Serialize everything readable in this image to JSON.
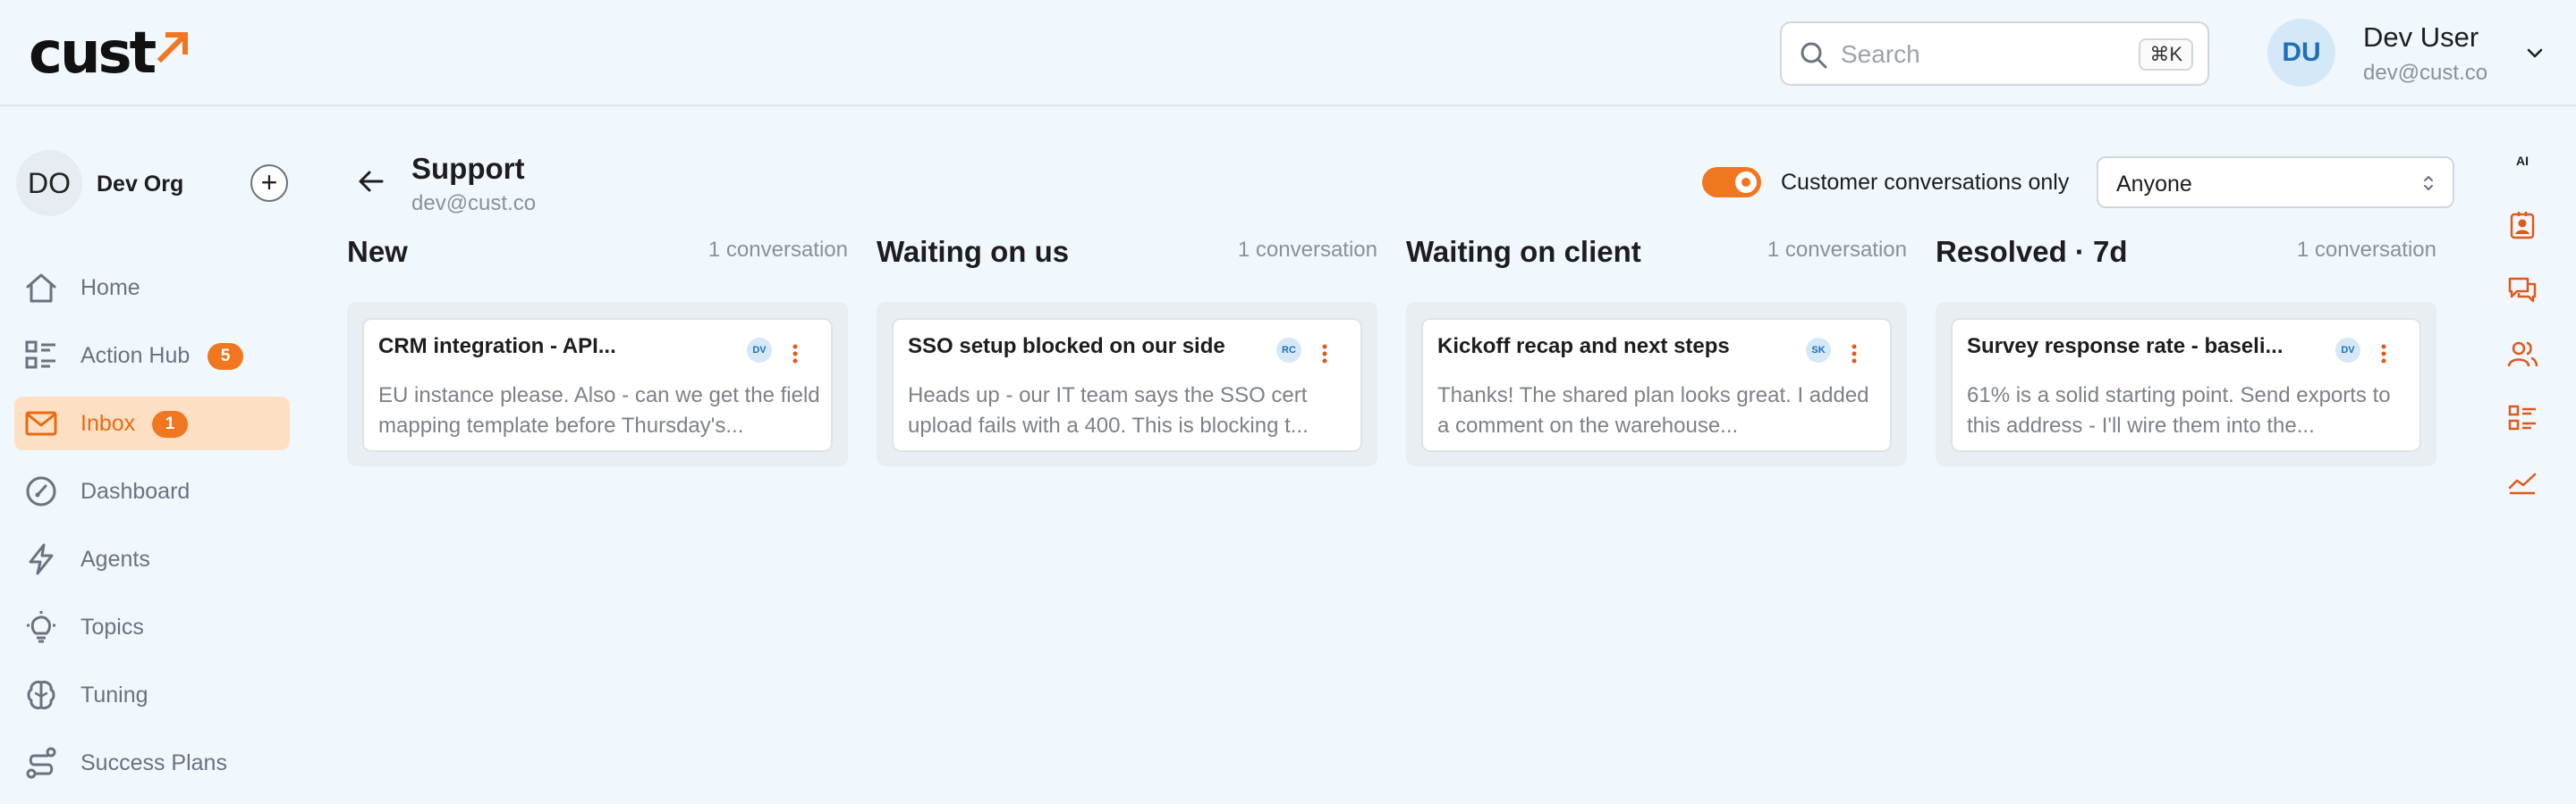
{
  "header": {
    "logo_text": "cust",
    "search": {
      "placeholder": "Search",
      "shortcut": "⌘K"
    },
    "user": {
      "initials": "DU",
      "name": "Dev User",
      "email": "dev@cust.co"
    }
  },
  "sidebar": {
    "org": {
      "initials": "DO",
      "name": "Dev Org",
      "add_label": "+"
    },
    "items": [
      {
        "label": "Home",
        "icon": "home-icon",
        "badge": null,
        "active": false
      },
      {
        "label": "Action Hub",
        "icon": "action-hub-icon",
        "badge": "5",
        "active": false
      },
      {
        "label": "Inbox",
        "icon": "mail-icon",
        "badge": "1",
        "active": true
      },
      {
        "label": "Dashboard",
        "icon": "gauge-icon",
        "badge": null,
        "active": false
      },
      {
        "label": "Agents",
        "icon": "lightning-icon",
        "badge": null,
        "active": false
      },
      {
        "label": "Topics",
        "icon": "lightbulb-icon",
        "badge": null,
        "active": false
      },
      {
        "label": "Tuning",
        "icon": "brain-icon",
        "badge": null,
        "active": false
      },
      {
        "label": "Success Plans",
        "icon": "route-icon",
        "badge": null,
        "active": false
      }
    ]
  },
  "main": {
    "title": "Support",
    "subtitle": "dev@cust.co",
    "toggle": {
      "label": "Customer conversations only",
      "on": true
    },
    "assignee_select": {
      "value": "Anyone"
    },
    "columns": [
      {
        "title": "New",
        "count": "1 conversation",
        "card": {
          "title": "CRM integration - API...",
          "avatar": "DV",
          "body": "EU instance please. Also - can we get the field mapping template before Thursday's..."
        }
      },
      {
        "title": "Waiting on us",
        "count": "1 conversation",
        "card": {
          "title": "SSO setup blocked on our side",
          "avatar": "RC",
          "body": "Heads up - our IT team says the SSO cert upload fails with a 400. This is blocking t..."
        }
      },
      {
        "title": "Waiting on client",
        "count": "1 conversation",
        "card": {
          "title": "Kickoff recap and next steps",
          "avatar": "SK",
          "body": "Thanks! The shared plan looks great. I added a comment on the warehouse..."
        }
      },
      {
        "title": "Resolved · 7d",
        "count": "1 conversation",
        "card": {
          "title": "Survey response rate - baseli...",
          "avatar": "DV",
          "body": "61% is a solid starting point. Send exports to this address - I'll wire them into the..."
        }
      }
    ]
  },
  "right_rail": {
    "ai_label": "AI",
    "icons": [
      "contact-card-icon",
      "chat-bubbles-icon",
      "users-icon",
      "checklist-icon",
      "trend-chart-icon"
    ]
  },
  "colors": {
    "accent": "#f07620",
    "accent_light": "#fde0c4",
    "background": "#f0f7fd",
    "avatar_blue": "#1e6fb8"
  }
}
